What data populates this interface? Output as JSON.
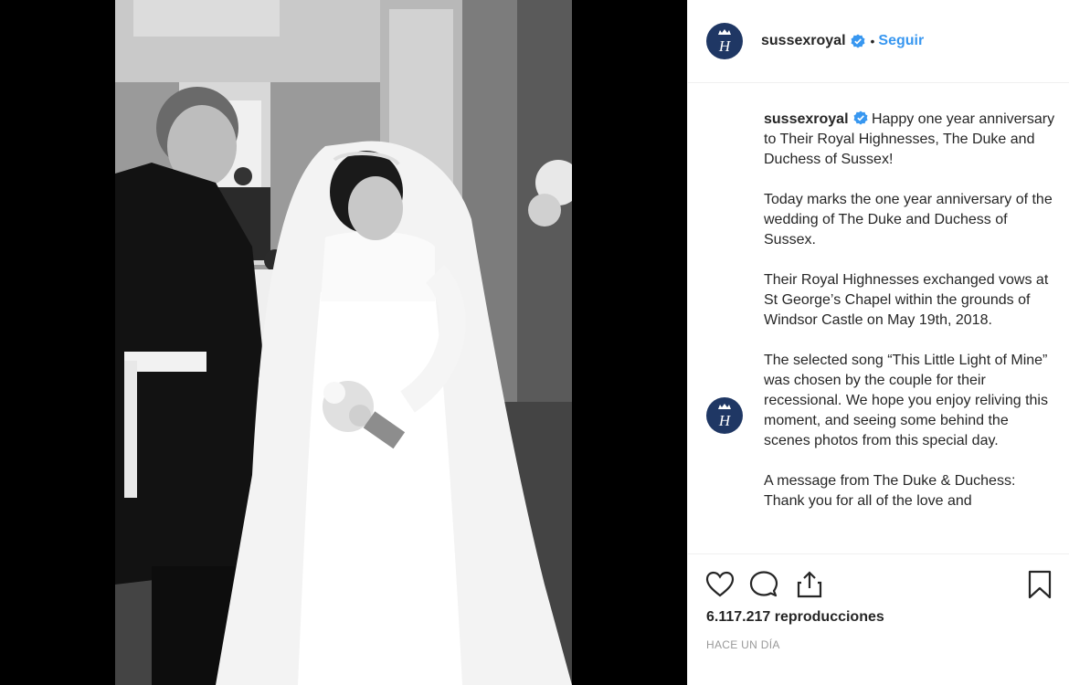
{
  "post": {
    "username": "sussexroyal",
    "follow_label": "Seguir",
    "dot": "•",
    "verified_icon": "verified-badge-icon",
    "avatar_icon": "crowned-monogram-h-icon",
    "avatar_color": "#1f3764"
  },
  "caption": {
    "author": "sussexroyal",
    "paragraphs": [
      "Happy one year anniversary to Their Royal Highnesses, The Duke and Duchess of Sussex!",
      "Today marks the one year anniversary of the wedding of The Duke and Duchess of Sussex.",
      "Their Royal Highnesses exchanged vows at St George’s Chapel within the grounds of Windsor Castle on May 19th, 2018.",
      "The selected song “This Little Light of Mine” was chosen by the couple for their recessional. We hope you enjoy reliving this moment, and seeing some behind the scenes photos from this special day.",
      "A message from The Duke & Duchess: Thank you for all of the love and"
    ]
  },
  "actions": {
    "like_icon": "heart-icon",
    "comment_icon": "comment-bubble-icon",
    "share_icon": "share-icon",
    "save_icon": "bookmark-icon",
    "views": "6.117.217 reproducciones",
    "time": "HACE UN DÍA"
  },
  "media": {
    "play_icon": "play-icon"
  },
  "colors": {
    "accent": "#3897f0",
    "text": "#262626",
    "muted": "#999999",
    "verified": "#3897f0"
  }
}
